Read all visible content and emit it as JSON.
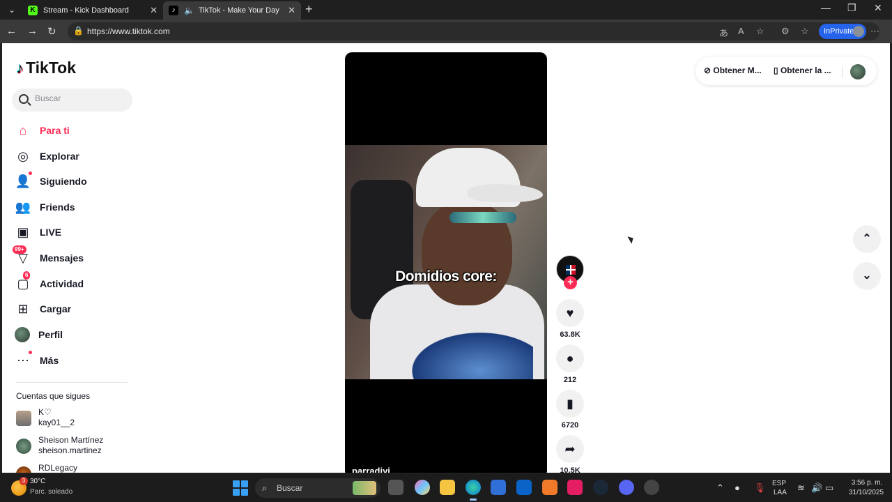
{
  "browser": {
    "tabs": [
      {
        "title": "Stream - Kick Dashboard",
        "favicon": "kick-favicon"
      },
      {
        "title": "TikTok - Make Your Day",
        "favicon": "tiktok-favicon",
        "active": true
      }
    ],
    "url": "https://www.tiktok.com",
    "inprivate_label": "InPrivate"
  },
  "sidebar": {
    "logo_text": "TikTok",
    "search_placeholder": "Buscar",
    "nav": [
      {
        "label": "Para ti",
        "icon": "home-icon",
        "active": true
      },
      {
        "label": "Explorar",
        "icon": "compass-icon"
      },
      {
        "label": "Siguiendo",
        "icon": "following-icon"
      },
      {
        "label": "Friends",
        "icon": "friends-icon"
      },
      {
        "label": "LIVE",
        "icon": "live-icon"
      },
      {
        "label": "Mensajes",
        "icon": "messages-icon",
        "badge": "99+"
      },
      {
        "label": "Actividad",
        "icon": "activity-icon",
        "badge": "6"
      },
      {
        "label": "Cargar",
        "icon": "upload-icon"
      },
      {
        "label": "Perfil",
        "icon": "profile-avatar"
      },
      {
        "label": "Más",
        "icon": "more-icon"
      }
    ],
    "following_header": "Cuentas que sigues",
    "following": [
      {
        "name": "K♡",
        "username": "kay01__2"
      },
      {
        "name": "Sheison Martínez",
        "username": "sheison.martinez"
      },
      {
        "name": "RDLegacy",
        "username": ""
      }
    ]
  },
  "video": {
    "caption": "Domidios core:",
    "author": "parradiyi",
    "likes": "63.8K",
    "comments": "212",
    "saves": "6720",
    "shares": "10.5K"
  },
  "top_right": {
    "item1": "Obtener M...",
    "item2": "Obtener la ..."
  },
  "taskbar": {
    "weather_badge": "3",
    "temperature": "30°C",
    "weather_desc": "Parc. soleado",
    "search_label": "Buscar",
    "language": "ESP",
    "layout": "LAA",
    "time": "3:56 p. m.",
    "date": "31/10/2025"
  }
}
